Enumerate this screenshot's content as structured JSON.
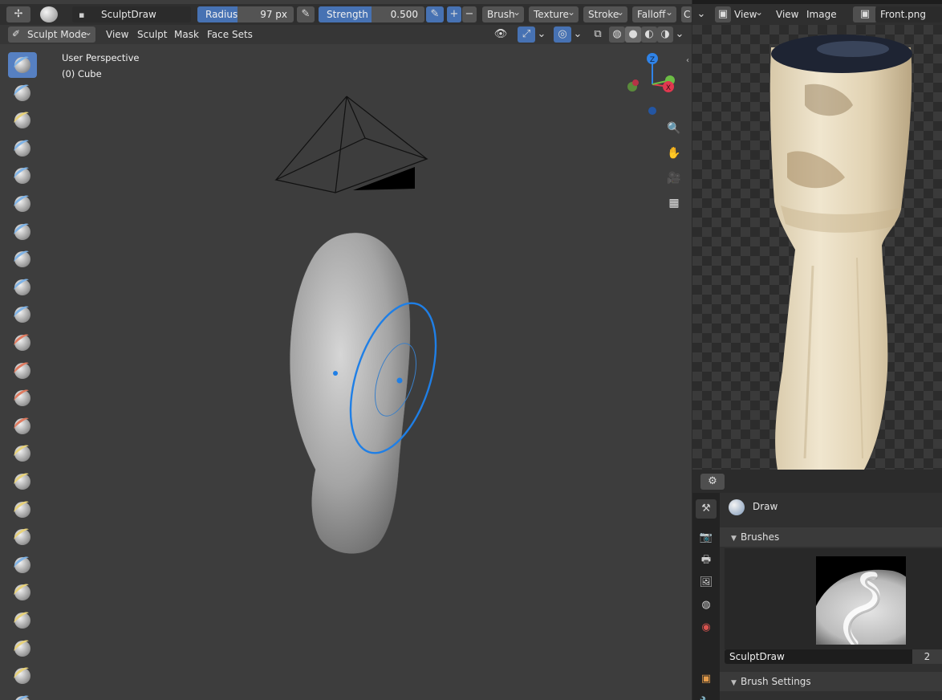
{
  "tool_header": {
    "brush_name": "SculptDraw",
    "radius_label": "Radius",
    "radius_value": "97 px",
    "radius_fill_fraction": 0.42,
    "strength_label": "Strength",
    "strength_value": "0.500",
    "strength_fill_fraction": 0.5,
    "plus_label": "+",
    "minus_label": "−",
    "menus": [
      "Brush",
      "Texture",
      "Stroke",
      "Falloff",
      "C"
    ]
  },
  "mode_header": {
    "mode_label": "Sculpt Mode",
    "menus": [
      "View",
      "Sculpt",
      "Mask",
      "Face Sets"
    ]
  },
  "viewport": {
    "perspective_text": "User Perspective",
    "object_text": "(0) Cube",
    "gizmo_axes": {
      "x_label": "X",
      "y_label": "Y",
      "z_label": "Z"
    },
    "colors": {
      "x_axis": "#e0384f",
      "y_axis": "#6cbd45",
      "z_axis": "#2f83e8",
      "brush_circle": "#1f7fe6",
      "mesh": "#a9a9a9"
    }
  },
  "toolbar": {
    "tools": [
      "draw",
      "draw-sharp",
      "clay",
      "clay-strips",
      "clay-thumb",
      "layer",
      "inflate",
      "blob",
      "crease",
      "smooth",
      "flatten",
      "fill",
      "scrape",
      "multiplane-scrape",
      "pinch",
      "grab",
      "elastic-deform",
      "snake-hook",
      "thumb",
      "pose",
      "nudge",
      "rotate",
      "slide-relax",
      "cloth"
    ],
    "active_index": 0
  },
  "image_editor": {
    "menus": [
      "View",
      "View",
      "Image"
    ],
    "image_name": "Front.png"
  },
  "properties": {
    "brush_label": "Draw",
    "brushes_panel_label": "Brushes",
    "brush_field_value": "SculptDraw",
    "brush_users": "2",
    "brush_settings_label": "Brush Settings",
    "tabs": [
      "tool",
      "render",
      "output",
      "view-layer",
      "scene",
      "world",
      "object",
      "modifiers"
    ]
  }
}
